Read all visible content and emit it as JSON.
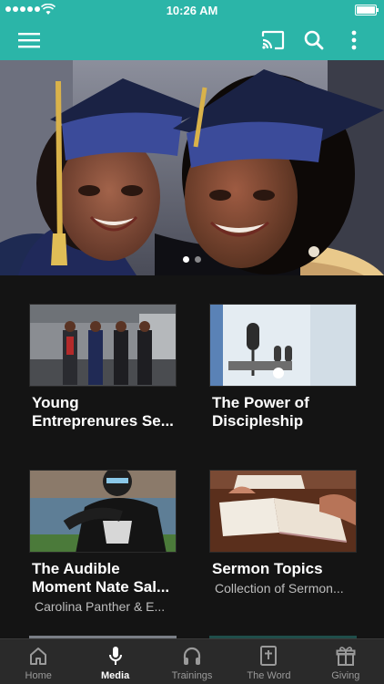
{
  "status_bar": {
    "time": "10:26 AM"
  },
  "app_bar": {
    "menu_icon": "hamburger-menu-icon",
    "cast_icon": "cast-icon",
    "search_icon": "search-icon",
    "more_icon": "more-vert-icon"
  },
  "hero": {
    "slide_count": 2,
    "active_slide": 1
  },
  "media_items": [
    {
      "title_line1": "Young",
      "title_line2": "Entreprenures Se...",
      "subtitle": ""
    },
    {
      "title_line1": "The Power of",
      "title_line2": "Discipleship",
      "subtitle": ""
    },
    {
      "title_line1": "The Audible",
      "title_line2": "Moment Nate Sal...",
      "subtitle": "Carolina Panther & E..."
    },
    {
      "title_line1": "Sermon Topics",
      "title_line2": "",
      "subtitle": "Collection of Sermon..."
    }
  ],
  "tabs": [
    {
      "label": "Home",
      "icon": "home-icon",
      "active": false
    },
    {
      "label": "Media",
      "icon": "microphone-icon",
      "active": true
    },
    {
      "label": "Trainings",
      "icon": "headphones-icon",
      "active": false
    },
    {
      "label": "The Word",
      "icon": "bible-icon",
      "active": false
    },
    {
      "label": "Giving",
      "icon": "gift-icon",
      "active": false
    }
  ],
  "colors": {
    "brand": "#2bb5a8",
    "background": "#141414",
    "tabbar": "#2a2a2a"
  }
}
